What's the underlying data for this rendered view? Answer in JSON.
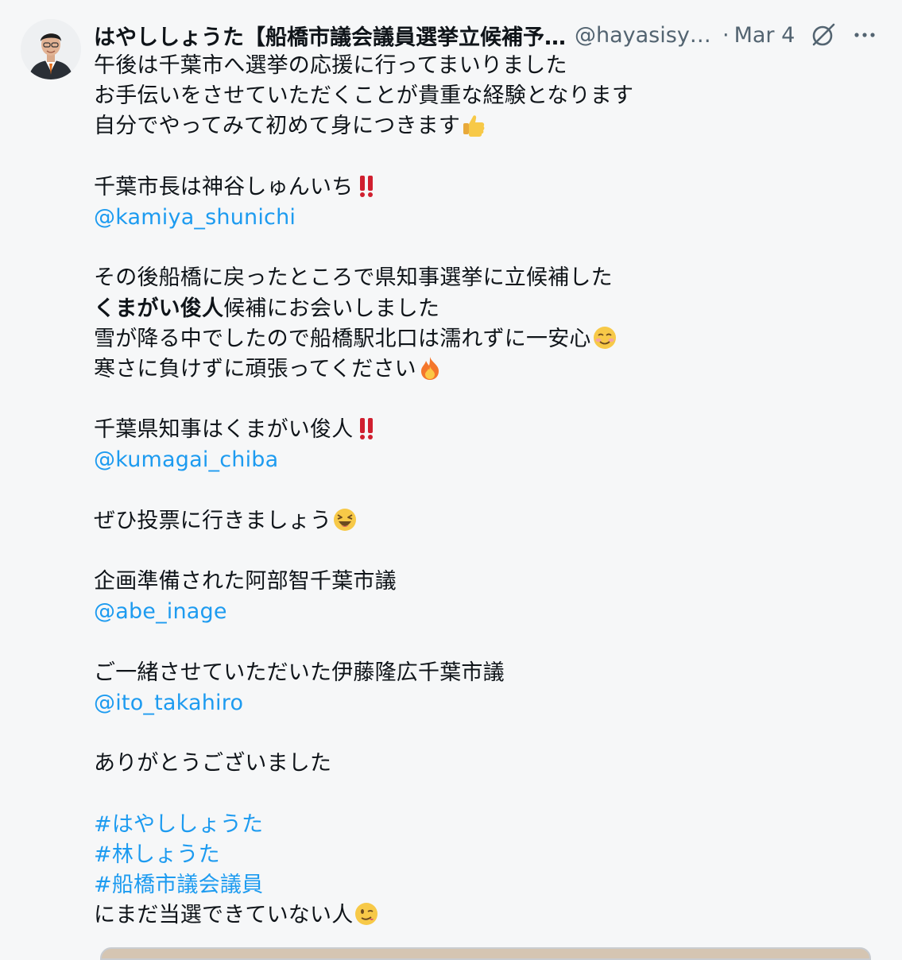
{
  "tweet": {
    "display_name": "はやししょうた【船橋市議会議員選挙立候補予定者】",
    "handle": "@hayasisyota",
    "separator": "·",
    "date": "Mar 4",
    "icons": {
      "avatar": "avatar-photo",
      "grok": "grok-icon",
      "more": "more-icon"
    },
    "colors": {
      "link": "#1d9bf0",
      "text": "#0f1419",
      "muted": "#536471",
      "background": "#f6f7f8"
    },
    "lines": [
      "午後は千葉市へ選挙の応援に行ってまいりました",
      "お手伝いをさせていただくことが貴重な経験となります",
      "自分でやってみて初めて身につきます",
      "千葉市長は神谷しゅんいち",
      "@kamiya_shunichi",
      "その後船橋に戻ったところで県知事選挙に立候補した",
      "くまがい俊人",
      "候補にお会いしました",
      "雪が降る中でしたので船橋駅北口は濡れずに一安心",
      "寒さに負けずに頑張ってください",
      "千葉県知事はくまがい俊人",
      "@kumagai_chiba",
      "ぜひ投票に行きましょう",
      "企画準備された阿部智千葉市議",
      "@abe_inage",
      "ご一緒させていただいた伊藤隆広千葉市議",
      "@ito_takahiro",
      "ありがとうございました",
      "#はやししょうた",
      "#林しょうた",
      "#船橋市議会議員",
      "にまだ当選できていない人"
    ]
  }
}
